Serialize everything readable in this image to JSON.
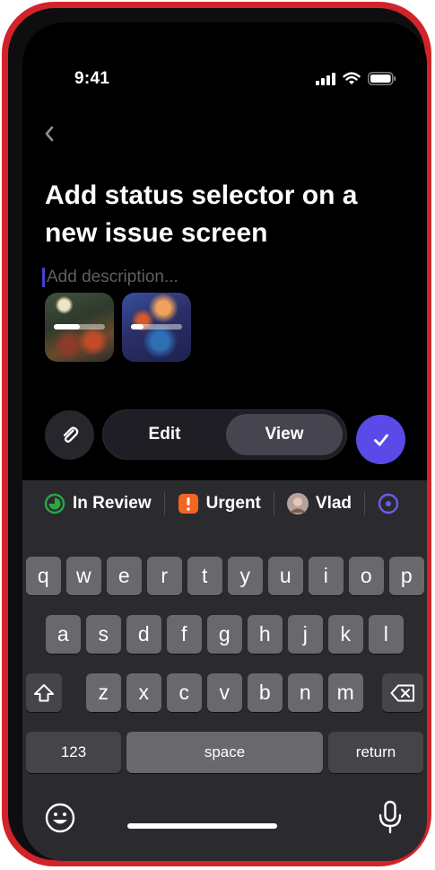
{
  "status_bar": {
    "time": "9:41"
  },
  "issue": {
    "title": "Add status selector on a new issue screen",
    "description_placeholder": "Add description...",
    "attachments": [
      {
        "name": "attachment-1",
        "upload_progress": 0.5
      },
      {
        "name": "attachment-2",
        "upload_progress": 0.25
      }
    ]
  },
  "mode_toggle": {
    "edit_label": "Edit",
    "view_label": "View",
    "selected": "View"
  },
  "chips": [
    {
      "label": "In Review",
      "icon": "in-review-status-icon",
      "color": "#29a745"
    },
    {
      "label": "Urgent",
      "icon": "urgent-priority-icon",
      "color": "#f26522"
    },
    {
      "label": "Vlad",
      "icon": "avatar"
    }
  ],
  "keyboard": {
    "row1": [
      "q",
      "w",
      "e",
      "r",
      "t",
      "y",
      "u",
      "i",
      "o",
      "p"
    ],
    "row2": [
      "a",
      "s",
      "d",
      "f",
      "g",
      "h",
      "j",
      "k",
      "l"
    ],
    "row3": [
      "z",
      "x",
      "c",
      "v",
      "b",
      "n",
      "m"
    ],
    "numbers_label": "123",
    "space_label": "space",
    "return_label": "return"
  },
  "colors": {
    "accent": "#5a4be8",
    "frame": "#d1232a"
  }
}
